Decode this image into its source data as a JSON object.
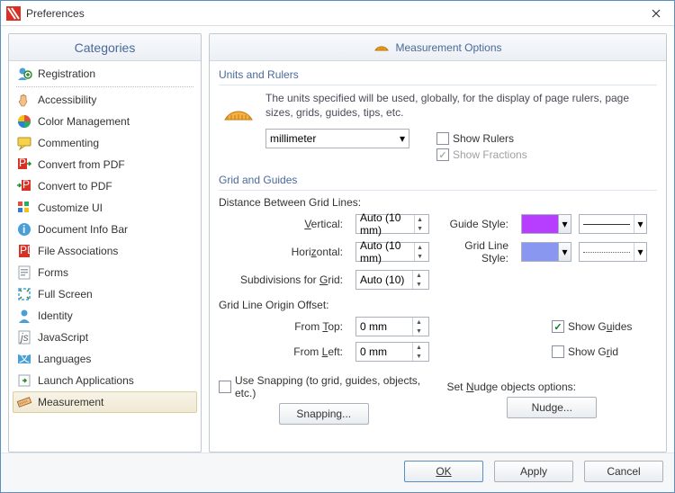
{
  "window": {
    "title": "Preferences"
  },
  "categories_header": "Categories",
  "categories": [
    {
      "label": "Registration",
      "icon": "person-plus"
    },
    {
      "label": "Accessibility",
      "icon": "hand"
    },
    {
      "label": "Color Management",
      "icon": "color-wheel"
    },
    {
      "label": "Commenting",
      "icon": "comment"
    },
    {
      "label": "Convert from PDF",
      "icon": "pdf-out"
    },
    {
      "label": "Convert to PDF",
      "icon": "pdf-in"
    },
    {
      "label": "Customize UI",
      "icon": "ui"
    },
    {
      "label": "Document Info Bar",
      "icon": "info"
    },
    {
      "label": "File Associations",
      "icon": "pdf-assoc"
    },
    {
      "label": "Forms",
      "icon": "form"
    },
    {
      "label": "Full Screen",
      "icon": "fullscreen"
    },
    {
      "label": "Identity",
      "icon": "person"
    },
    {
      "label": "JavaScript",
      "icon": "js"
    },
    {
      "label": "Languages",
      "icon": "lang"
    },
    {
      "label": "Launch Applications",
      "icon": "launch"
    },
    {
      "label": "Measurement",
      "icon": "ruler",
      "selected": true
    }
  ],
  "options_header": "Measurement Options",
  "units_group": {
    "title": "Units and Rulers",
    "description": "The units specified will be used, globally, for the display of page rulers, page sizes, grids, guides, tips, etc.",
    "unit_value": "millimeter",
    "show_rulers_label": "Show Rulers",
    "show_rulers_checked": false,
    "show_fractions_label": "Show Fractions",
    "show_fractions_checked": true,
    "show_fractions_enabled": false
  },
  "grid_group": {
    "title": "Grid and Guides",
    "distance_label": "Distance Between Grid Lines:",
    "vertical_label": "Vertical:",
    "vertical_value": "Auto (10 mm)",
    "horizontal_label": "Horizontal:",
    "horizontal_value": "Auto (10 mm)",
    "subdivisions_label": "Subdivisions for Grid:",
    "subdivisions_value": "Auto (10)",
    "guide_style_label": "Guide Style:",
    "guide_color": "#b83eff",
    "gridline_style_label": "Grid Line Style:",
    "gridline_color": "#8a97f0",
    "origin_label": "Grid Line Origin Offset:",
    "from_top_label": "From Top:",
    "from_top_value": "0 mm",
    "from_left_label": "From Left:",
    "from_left_value": "0 mm",
    "show_guides_label": "Show Guides",
    "show_guides_checked": true,
    "show_grid_label": "Show Grid",
    "show_grid_checked": false,
    "use_snapping_label": "Use Snapping (to grid, guides, objects, etc.)",
    "use_snapping_checked": false,
    "snapping_button": "Snapping...",
    "nudge_label": "Set Nudge objects options:",
    "nudge_button": "Nudge..."
  },
  "footer": {
    "ok": "OK",
    "apply": "Apply",
    "cancel": "Cancel"
  }
}
